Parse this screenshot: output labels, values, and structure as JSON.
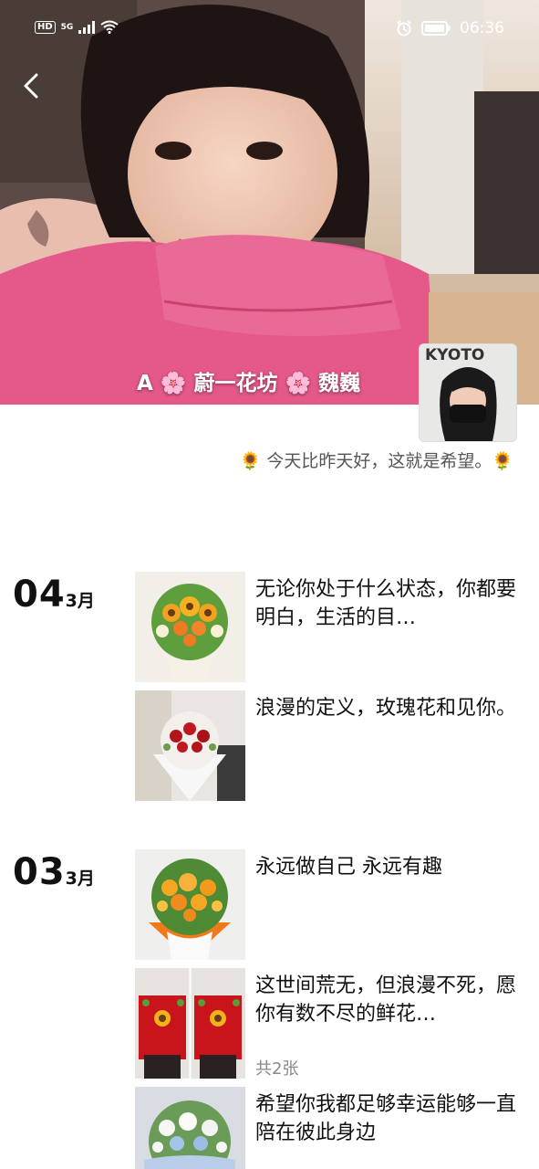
{
  "status_bar": {
    "network_hd": "HD",
    "network_5g": "5G",
    "time": "06:36",
    "icons": [
      "signal-icon",
      "wifi-icon",
      "alarm-icon",
      "battery-icon"
    ]
  },
  "profile": {
    "cover_image": "girl-in-pink-sweater-photo",
    "name": "A 🌸 蔚一花坊 🌸 魏巍",
    "avatar_label": "KYOTO",
    "signature": "🌻 今天比昨天好，这就是希望。🌻"
  },
  "posts": [
    {
      "day": "04",
      "month": "3月",
      "entries": [
        {
          "text": "无论你处于什么状态，你都要明白，生活的目…",
          "image": "sunflower-rose-bouquet-white"
        },
        {
          "text": "浪漫的定义，玫瑰花和见你。",
          "image": "red-rose-bouquet"
        }
      ]
    },
    {
      "day": "03",
      "month": "3月",
      "entries": [
        {
          "text": "永远做自己 永远有趣",
          "image": "orange-rose-bouquet"
        },
        {
          "text": "这世间荒无，但浪漫不死，愿你有数不尽的鲜花…",
          "image": "two-red-flower-baskets",
          "count": "共2张"
        },
        {
          "text": "希望你我都足够幸运能够一直陪在彼此身边",
          "image": "white-blue-bouquet"
        }
      ]
    }
  ],
  "colors": {
    "sweater_pink": "#e4588a",
    "text": "#111111",
    "muted": "#888888"
  }
}
